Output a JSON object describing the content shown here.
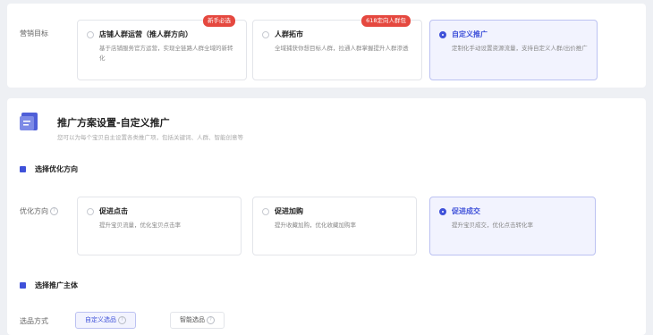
{
  "marketing_goal": {
    "label": "营销目标",
    "options": [
      {
        "title": "店铺人群运营（推人群方向）",
        "desc": "基于店铺服务官方运营，实现全链路人群全域的新转化",
        "badge": "新手必选",
        "selected": false
      },
      {
        "title": "人群拓市",
        "desc": "全域捕获你想目标人群，拉通人群掌握提升人群渗透",
        "badge": "618定向人群包",
        "selected": false
      },
      {
        "title": "自定义推广",
        "desc": "定制化手动设置资源流量，支持自定义人群/出价推广",
        "badge": "",
        "selected": true
      }
    ]
  },
  "plan": {
    "icon": "document-icon",
    "title": "推广方案设置-自定义推广",
    "subtitle": "您可以为每个宝贝自主设置各类推广项，包括关键词、人群、智能创意等"
  },
  "optimization": {
    "section_title": "选择优化方向",
    "label": "优化方向",
    "help": "?",
    "options": [
      {
        "title": "促进点击",
        "desc": "提升宝贝流量，优化宝贝点击率",
        "selected": false
      },
      {
        "title": "促进加购",
        "desc": "提升收藏加购，优化收藏加购率",
        "selected": false
      },
      {
        "title": "促进成交",
        "desc": "提升宝贝成交，优化点击转化率",
        "selected": true
      }
    ]
  },
  "subject": {
    "section_title": "选择推广主体",
    "label": "选品方式",
    "tabs": [
      {
        "label": "自定义选品",
        "help": "?",
        "active": true
      },
      {
        "label": "智能选品",
        "help": "?",
        "active": false
      }
    ]
  },
  "colors": {
    "accent": "#3f51d9",
    "badge": "#e5483f",
    "selected_bg": "#f2f3fe"
  }
}
